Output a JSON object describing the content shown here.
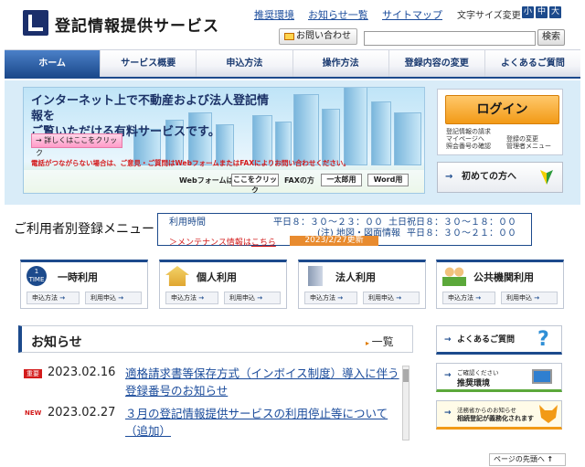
{
  "header": {
    "title": "登記情報提供サービス",
    "links": [
      "推奨環境",
      "お知らせ一覧",
      "サイトマップ"
    ],
    "font_size_label": "文字サイズ変更",
    "font_sizes": [
      "小",
      "中",
      "大"
    ],
    "contact": "お問い合わせ",
    "search_button": "検索"
  },
  "nav": [
    "ホーム",
    "サービス概要",
    "申込方法",
    "操作方法",
    "登録内容の変更",
    "よくあるご質問"
  ],
  "hero": {
    "line1": "インターネット上で不動産および法人登記情報を",
    "line2": "ご覧いただける有料サービスです。",
    "detail": "→ 詳しくはここをクリック",
    "warning": "電話がつながらない場合は、ご意見・ご質問はWebフォームまたはFAXによりお問い合わせください。",
    "webform": "Webフォームは",
    "click_here": "ここをクリック",
    "fax": "FAXの方",
    "ichitaro": "一太郎用",
    "word": "Word用"
  },
  "login": {
    "label": "ログイン",
    "items": [
      "登記情報の請求",
      "マイページへ",
      "登録の変更",
      "照会番号の確認",
      "管理者メニュー"
    ],
    "first_time": "初めての方へ"
  },
  "menu": {
    "title": "ご利用者別登録メニュー",
    "hours_label": "利用時間",
    "weekday": "平日８：３０～２３：００",
    "holiday": "土日祝日８：３０～１８：００",
    "note": "(注) 地図・図面情報",
    "note_hours": "平日８：３０～２１：００",
    "maintenance": "＞メンテナンス情報は",
    "here": "こちら",
    "date": "2023/2/27更新"
  },
  "cards": [
    {
      "title": "一時利用",
      "icon_text": "1\nTIME",
      "b1": "申込方法",
      "b2": "利用申込"
    },
    {
      "title": "個人利用",
      "b1": "申込方法",
      "b2": "利用申込"
    },
    {
      "title": "法人利用",
      "b1": "申込方法",
      "b2": "利用申込"
    },
    {
      "title": "公共機関利用",
      "b1": "申込方法",
      "b2": "利用申込"
    }
  ],
  "news": {
    "title": "お知らせ",
    "all": "一覧",
    "items": [
      {
        "badge": "重要",
        "date": "2023.02.16",
        "text1": "適格請求書等保存方式（インボイス制度）導入に伴う",
        "text2": "登録番号のお知らせ"
      },
      {
        "badge": "NEW",
        "date": "2023.02.27",
        "text1": "３月の登記情報提供サービスの利用停止等について",
        "text2": "（追加）"
      }
    ]
  },
  "side": {
    "faq": "よくあるご質問",
    "env_small": "ご確認ください",
    "env": "推奨環境",
    "heir_small": "法務省からのお知らせ",
    "heir": "相続登記が義務化されます"
  },
  "pagetop": "ページの先頭へ",
  "colors": {
    "primary": "#1c4a8c",
    "accent": "#f29a16",
    "alert": "#d31b1b"
  }
}
